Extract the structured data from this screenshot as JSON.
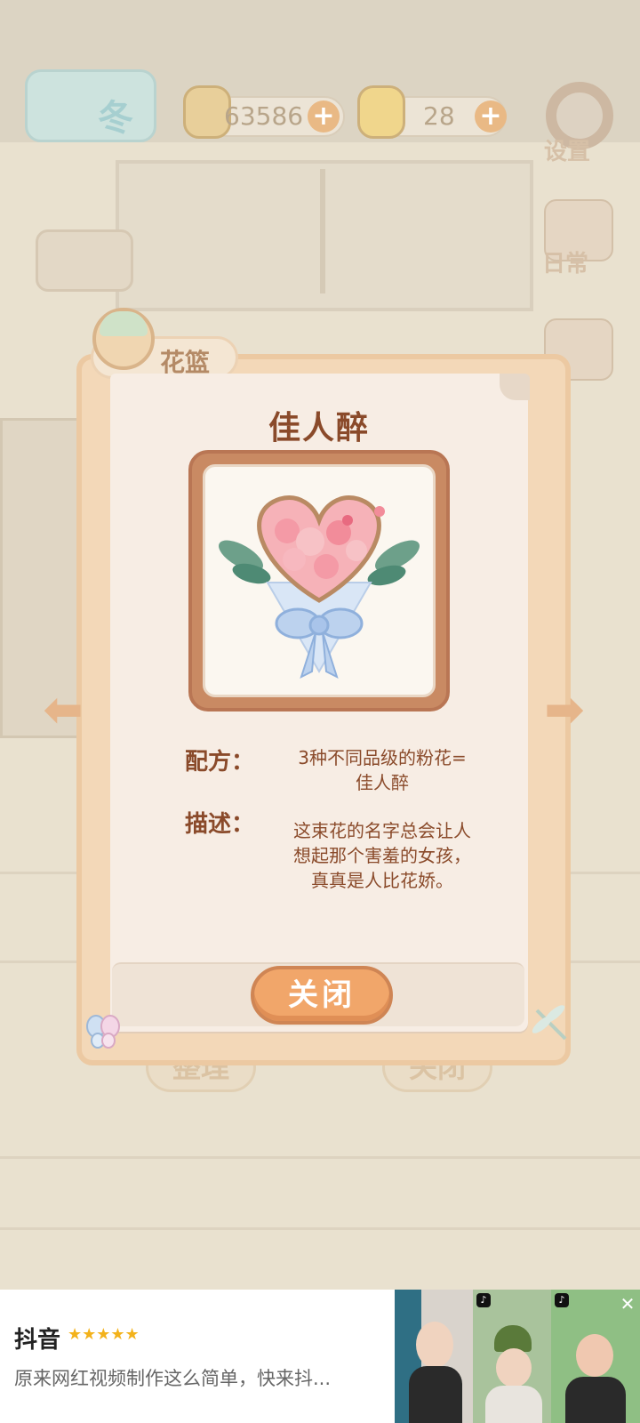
{
  "hud": {
    "season": "冬",
    "fish_coins": "63586",
    "cheese": "28",
    "settings_label": "设置",
    "daily_label": "日常"
  },
  "panel": {
    "tab_label": "花篮",
    "flower_name": "佳人醉",
    "recipe_label": "配方：",
    "recipe_line1": "3种不同品级的粉花=",
    "recipe_line2": "佳人醉",
    "desc_label": "描述：",
    "desc_line1": "这束花的名字总会让人",
    "desc_line2": "想起那个害羞的女孩，",
    "desc_line3": "真真是人比花娇。",
    "close_label": "关闭",
    "prev_arrow": "⬅",
    "next_arrow": "➡"
  },
  "background_buttons": {
    "organize": "整理",
    "close": "关闭"
  },
  "ad": {
    "app_name": "抖音",
    "stars": "★★★★★",
    "description": "原来网红视频制作这么简单，快来抖...",
    "close_icon": "✕"
  },
  "colors": {
    "accent_orange": "#f1a66a",
    "text_brown": "#8a4a2a",
    "paper": "#f7ede4",
    "frame": "#c98a63"
  }
}
